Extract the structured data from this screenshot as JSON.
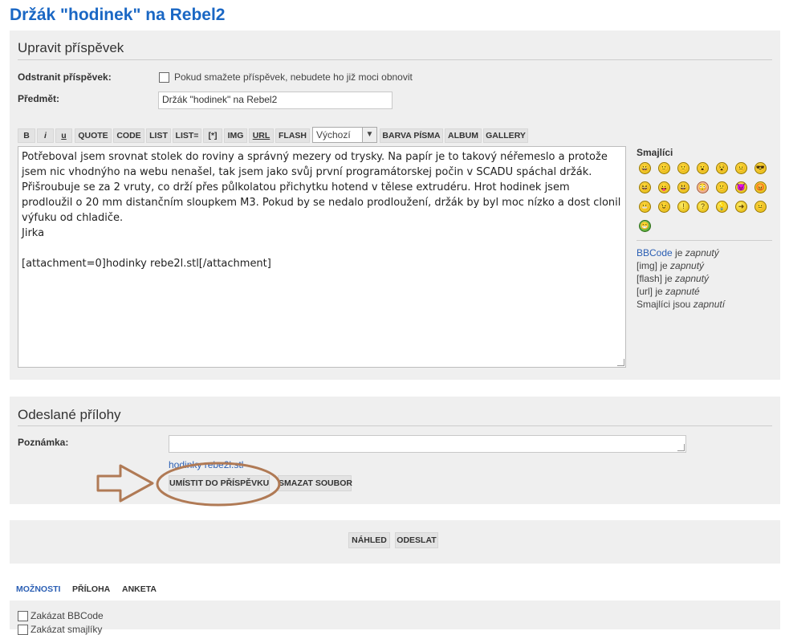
{
  "page": {
    "title": "Držák \"hodinek\" na Rebel2"
  },
  "edit": {
    "heading": "Upravit příspěvek",
    "delete_label": "Odstranit příspěvek:",
    "delete_hint": "Pokud smažete příspěvek, nebudete ho již moci obnovit",
    "subject_label": "Předmět:",
    "subject_value": "Držák \"hodinek\" na Rebel2"
  },
  "toolbar": {
    "buttons": [
      "B",
      "i",
      "u",
      "Quote",
      "Code",
      "List",
      "List=",
      "[*]",
      "Img",
      "URL",
      "Flash"
    ],
    "font_size": "Výchozí",
    "buttons2": [
      "Barva písma",
      "Album",
      "Gallery"
    ]
  },
  "message": {
    "paragraph": "Potřeboval jsem srovnat stolek do roviny a správný mezery od trysky. Na papír je to takový néřemeslo a protože jsem nic vhodnýho na webu nenašel, tak jsem jako svůj první programátorskej počin v SCADU spáchal držák. Přišroubuje se za 2 vruty, co drží přes půlkolatou přichytku hotend  v tělese extrudéru. Hrot hodinek jsem prodloužil o 20 mm distančním sloupkem M3. Pokud by se nedalo prodloužení, držák by byl moc nízko a dost clonil výfuku od chladiče.",
    "signature": "Jirka",
    "attachment": "[attachment=0]hodinky rebe2l.stl[/attachment]"
  },
  "smilies": {
    "title": "Smajlíci",
    "faces": [
      "😀",
      "🙂",
      "🙁",
      "😮",
      "😵",
      "😐",
      "😎",
      "😆",
      "😛",
      "😃",
      "😳",
      "😕",
      "😈",
      "😡",
      "😬",
      "😉",
      "!",
      "?",
      "💡",
      "➜",
      "😐",
      "😁"
    ]
  },
  "status": {
    "bbcode_link": "BBCode",
    "bbcode_suffix": " je ",
    "bbcode_state": "zapnutý",
    "img_prefix": "[img] je ",
    "img_state": "zapnutý",
    "flash_prefix": "[flash] je ",
    "flash_state": "zapnutý",
    "url_prefix": "[url] je ",
    "url_state": "zapnuté",
    "smilies_prefix": "Smajlíci jsou ",
    "smilies_state": "zapnutí"
  },
  "attachments": {
    "heading": "Odeslané přílohy",
    "note_label": "Poznámka:",
    "filename": "hodinky rebe2l.stl",
    "place_button": "Umístit do příspěvku",
    "delete_button": "Smazat soubor"
  },
  "submit": {
    "preview": "Náhled",
    "send": "Odeslat"
  },
  "tabs": {
    "options": "Možnosti",
    "attachment": "Příloha",
    "poll": "Anketa"
  },
  "options": {
    "disable_bbcode": "Zakázat BBCode",
    "disable_smilies": "Zakázat smajlíky"
  },
  "colors": {
    "title": "#1a67c4",
    "link": "#2b5fb4",
    "annotation": "#b07a55",
    "panel": "#efefef"
  }
}
